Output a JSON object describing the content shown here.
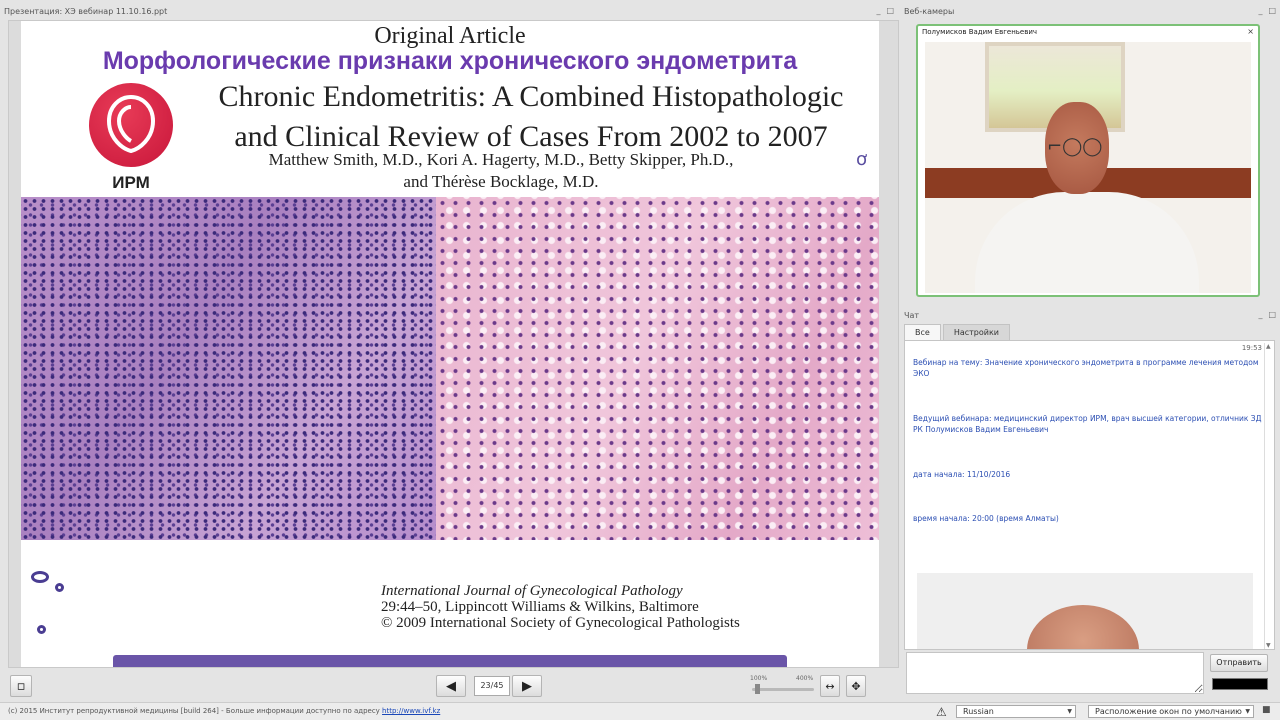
{
  "presentation": {
    "panel_title": "Презентация: ХЭ вебинар 11.10.16.ppt",
    "slide": {
      "original_article": "Original Article",
      "ru_title": "Морфологические признаки хронического эндометрита",
      "en_title_line1": "Chronic Endometritis: A Combined Histopathologic",
      "en_title_line2": "and Clinical Review of Cases From 2002 to 2007",
      "authors_line1": "Matthew Smith, M.D., Kori A. Hagerty, M.D., Betty Skipper, Ph.D.,",
      "authors_line2": "and Thérèse Bocklage, M.D.",
      "logo_text": "ИРМ",
      "journal_name": "International Journal of Gynecological Pathology",
      "journal_line2": "29:44–50, Lippincott Williams & Wilkins, Baltimore",
      "journal_line3": "© 2009 International Society of Gynecological Pathologists"
    },
    "toolbar": {
      "prev_icon": "arrow-left-icon",
      "next_icon": "arrow-right-icon",
      "page_counter": "23/45",
      "zoom_min": "100%",
      "zoom_max": "400%",
      "zoom_fraction": 0.05
    }
  },
  "webcams": {
    "panel_title": "Веб-камеры",
    "presenter_name": "Полумисков Вадим Евгеньевич",
    "close_label": "×"
  },
  "chat": {
    "panel_title": "Чат",
    "tabs": [
      {
        "label": "Все",
        "active": true
      },
      {
        "label": "Настройки",
        "active": false
      }
    ],
    "time": "19:53",
    "messages": [
      "Вебинар на тему: Значение хронического эндометрита в программе лечения методом ЭКО",
      "Ведущий вебинара: медицинский директор ИРМ, врач высшей категории, отличник ЗД РК  Полумисков Вадим Евгеньевич",
      "дата начала: 11/10/2016",
      "время начала: 20:00 (время Алматы)"
    ],
    "send_label": "Отправить",
    "input_value": ""
  },
  "footer": {
    "copyright": "(c) 2015 Институт репродуктивной медицины [build 264] - Больше информации доступно по адресу ",
    "link": "http://www.ivf.kz",
    "language": "Russian",
    "layout": "Расположение окон по умолчанию"
  },
  "colors": {
    "accent_purple": "#6a3bae",
    "logo_red": "#d42244",
    "chat_text": "#2c4fb3",
    "cam_border": "#7cc177"
  }
}
